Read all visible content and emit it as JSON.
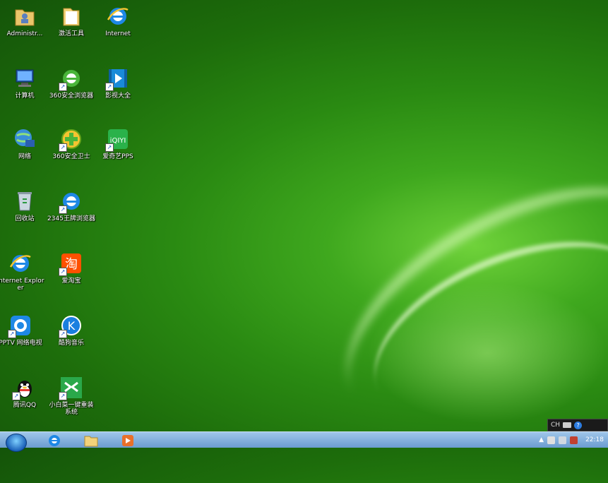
{
  "desktop": {
    "icons": [
      {
        "label": "Administr...",
        "icon": "user-folder-icon"
      },
      {
        "label": "激活工具",
        "icon": "folder-icon"
      },
      {
        "label": "Internet",
        "icon": "ie-icon"
      },
      {
        "label": "计算机",
        "icon": "computer-icon"
      },
      {
        "label": "360安全浏览器",
        "icon": "360-browser-icon"
      },
      {
        "label": "影视大全",
        "icon": "video-icon"
      },
      {
        "label": "网络",
        "icon": "network-icon"
      },
      {
        "label": "360安全卫士",
        "icon": "360-security-icon"
      },
      {
        "label": "爱奇艺PPS",
        "icon": "iqiyi-icon"
      },
      {
        "label": "回收站",
        "icon": "recycle-bin-icon"
      },
      {
        "label": "2345王牌浏览器",
        "icon": "2345-browser-icon"
      },
      {
        "label": "Internet Explorer",
        "icon": "ie-icon"
      },
      {
        "label": "爱淘宝",
        "icon": "taobao-icon"
      },
      {
        "label": "PPTV 网络电视",
        "icon": "pptv-icon"
      },
      {
        "label": "酷狗音乐",
        "icon": "kugou-icon"
      },
      {
        "label": "腾讯QQ",
        "icon": "qq-icon"
      },
      {
        "label": "小白菜一键重装系统",
        "icon": "reinstall-icon"
      }
    ]
  },
  "language_bar": {
    "lang": "CH",
    "help": "?"
  },
  "taskbar": {
    "pinned": [
      "start-orb",
      "ie-icon",
      "explorer-icon",
      "media-player-icon"
    ],
    "clock": "22:18"
  },
  "colors": {
    "desktop_green": "#2a8a12",
    "taskbar_blue": "#6b9cd0"
  }
}
